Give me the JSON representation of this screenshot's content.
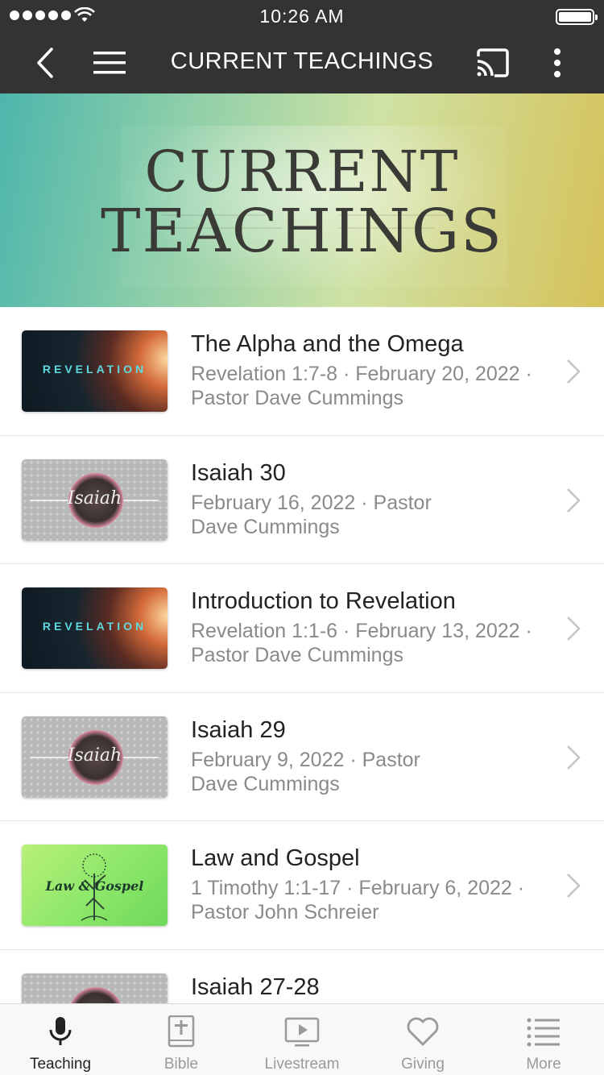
{
  "status_bar": {
    "time": "10:26 AM"
  },
  "nav": {
    "title": "CURRENT TEACHINGS"
  },
  "banner": {
    "line1": "CURRENT",
    "line2": "TEACHINGS"
  },
  "teachings": [
    {
      "title": "The Alpha and the Omega",
      "subtitle": "Revelation 1:7-8 · February 20, 2022 · Pastor Dave Cummings",
      "thumb_text": "REVELATION",
      "thumb": "revelation"
    },
    {
      "title": "Isaiah 30",
      "subtitle": "February 16, 2022 · Pastor Dave Cummings",
      "thumb_text": "Isaiah",
      "thumb": "isaiah"
    },
    {
      "title": "Introduction to Revelation",
      "subtitle": "Revelation 1:1-6 · February 13, 2022 · Pastor Dave Cummings",
      "thumb_text": "REVELATION",
      "thumb": "revelation"
    },
    {
      "title": "Isaiah 29",
      "subtitle": "February 9, 2022 · Pastor Dave Cummings",
      "thumb_text": "Isaiah",
      "thumb": "isaiah"
    },
    {
      "title": "Law and Gospel",
      "subtitle": "1 Timothy 1:1-17 · February 6, 2022 · Pastor John Schreier",
      "thumb_text": "Law & Gospel",
      "thumb": "law"
    },
    {
      "title": "Isaiah 27-28",
      "subtitle": "",
      "thumb_text": "",
      "thumb": "isaiah"
    }
  ],
  "tabs": [
    {
      "label": "Teaching",
      "icon": "microphone-icon",
      "active": true
    },
    {
      "label": "Bible",
      "icon": "bible-icon",
      "active": false
    },
    {
      "label": "Livestream",
      "icon": "tv-play-icon",
      "active": false
    },
    {
      "label": "Giving",
      "icon": "heart-icon",
      "active": false
    },
    {
      "label": "More",
      "icon": "list-icon",
      "active": false
    }
  ],
  "colors": {
    "nav_bg": "#333333",
    "tab_active": "#222222",
    "tab_inactive": "#9a9a9a"
  }
}
